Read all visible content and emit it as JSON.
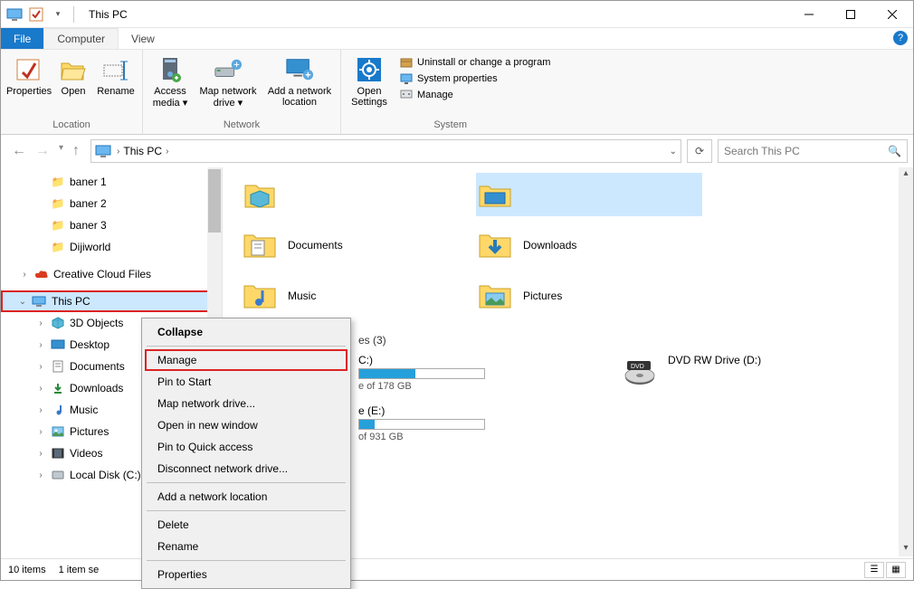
{
  "titlebar": {
    "title": "This PC"
  },
  "menu": {
    "file": "File",
    "computer": "Computer",
    "view": "View"
  },
  "ribbon": {
    "location": {
      "label": "Location",
      "properties": "Properties",
      "open": "Open",
      "rename": "Rename"
    },
    "network": {
      "label": "Network",
      "access_media": "Access media ▾",
      "map_drive": "Map network drive ▾",
      "add_location": "Add a network location"
    },
    "system": {
      "label": "System",
      "open_settings": "Open Settings",
      "uninstall": "Uninstall or change a program",
      "sys_props": "System properties",
      "manage": "Manage"
    }
  },
  "addr": {
    "path": "This PC",
    "chev": "›"
  },
  "search": {
    "placeholder": "Search This PC"
  },
  "sidebar": {
    "baner1": "baner 1",
    "baner2": "baner 2",
    "baner3": "baner 3",
    "dijiworld": "Dijiworld",
    "creative": "Creative Cloud Files",
    "thispc": "This PC",
    "obj3d": "3D Objects",
    "desktop": "Desktop",
    "documents": "Documents",
    "downloads": "Downloads",
    "music": "Music",
    "pictures": "Pictures",
    "videos": "Videos",
    "localdisk": "Local Disk (C:)"
  },
  "content": {
    "row0_right_partial": "",
    "documents": "Documents",
    "downloads": "Downloads",
    "music": "Music",
    "pictures": "Pictures",
    "devices_header": "es (3)",
    "drive_c": {
      "name": "C:)",
      "sub": "e of 178 GB",
      "fill": 45
    },
    "drive_d": {
      "name": "DVD RW Drive (D:)"
    },
    "drive_e": {
      "name": "e (E:)",
      "sub": "of 931 GB",
      "fill": 12
    }
  },
  "status": {
    "items": "10 items",
    "selected": "1 item se"
  },
  "context": {
    "collapse": "Collapse",
    "manage": "Manage",
    "pin_start": "Pin to Start",
    "map": "Map network drive...",
    "open_new": "Open in new window",
    "pin_quick": "Pin to Quick access",
    "disconnect": "Disconnect network drive...",
    "add_loc": "Add a network location",
    "delete": "Delete",
    "rename": "Rename",
    "properties": "Properties"
  }
}
